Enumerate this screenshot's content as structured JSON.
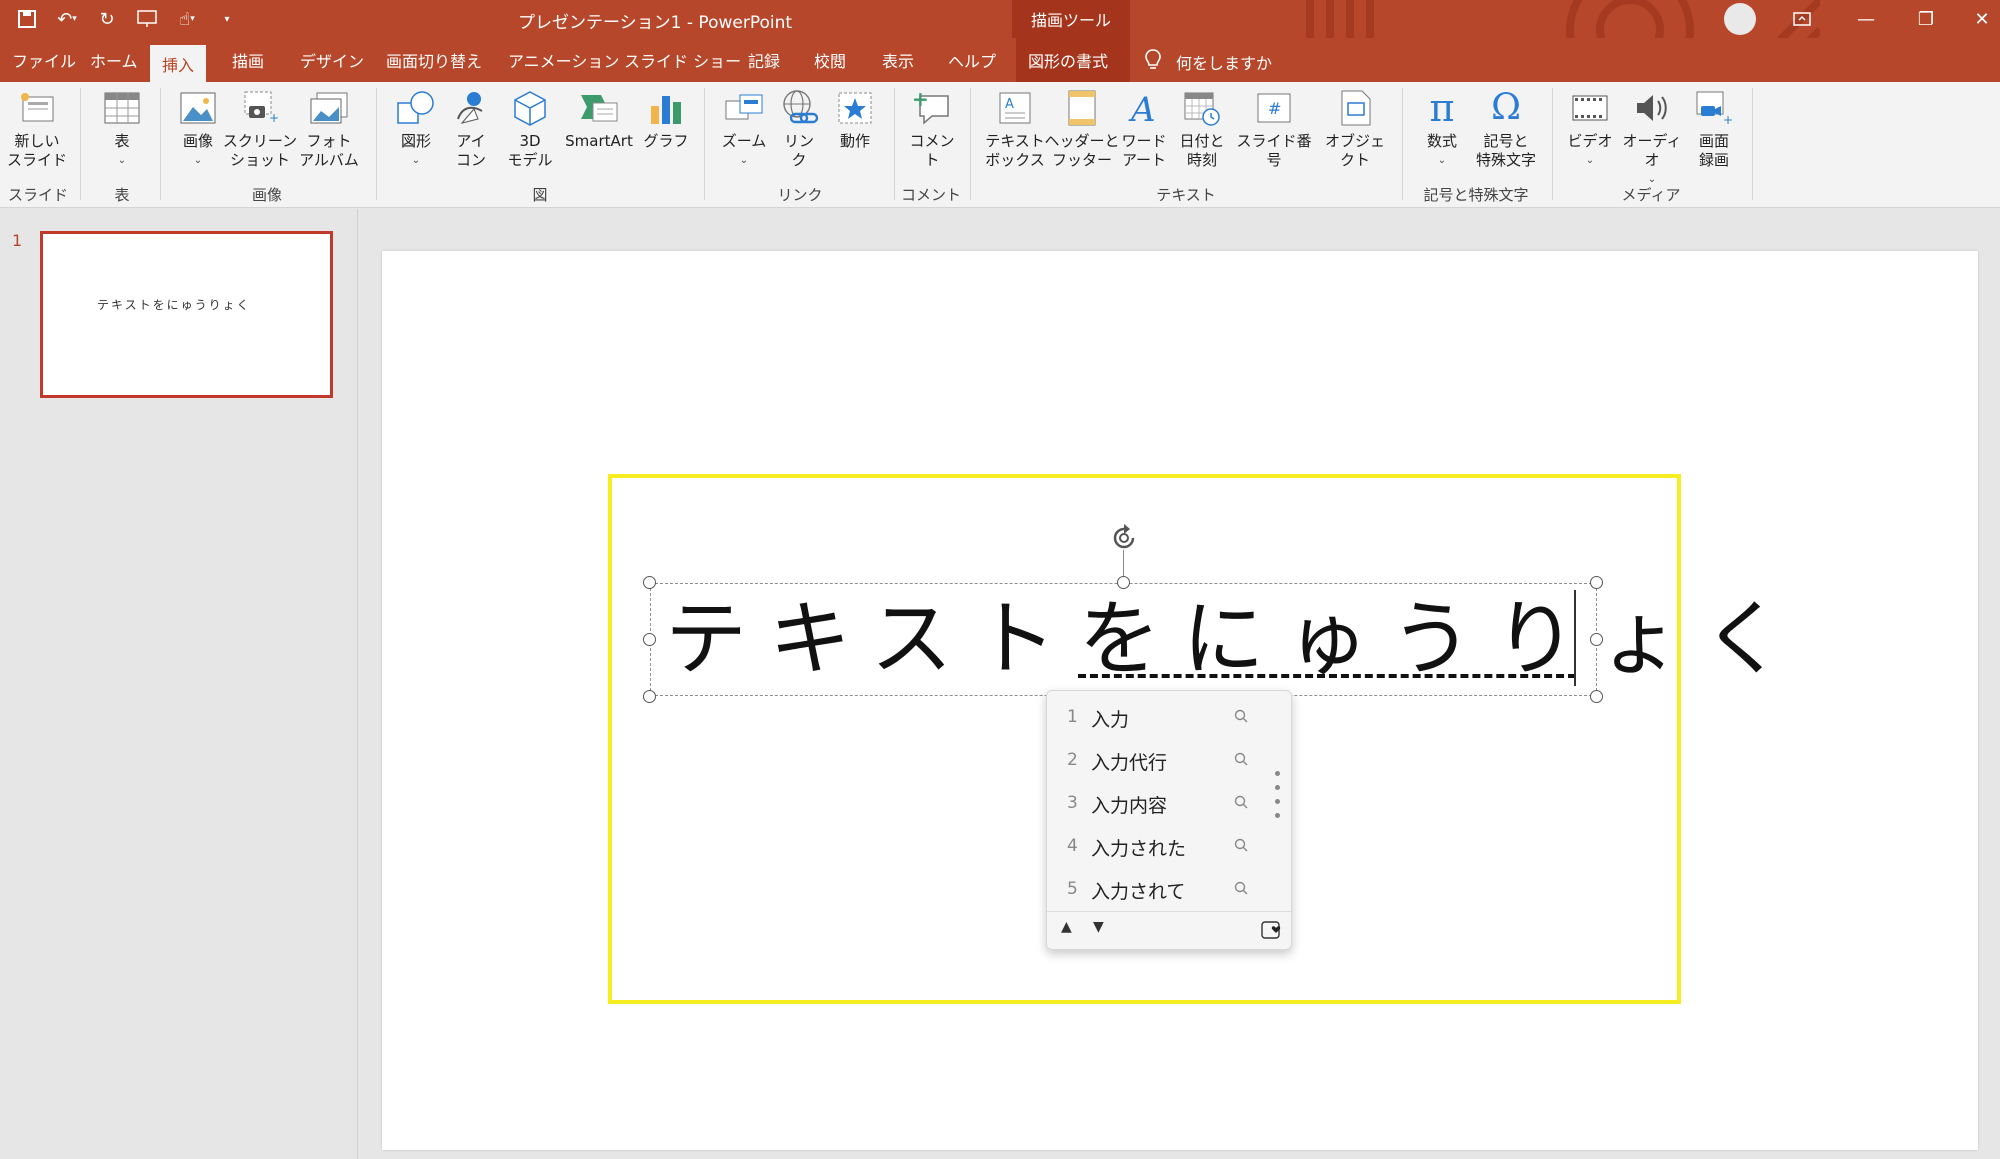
{
  "title_bar": {
    "document_title": "プレゼンテーション1  -  PowerPoint",
    "context_group": "描画ツール"
  },
  "tabs": [
    {
      "label": "ファイル"
    },
    {
      "label": "ホーム"
    },
    {
      "label": "挿入"
    },
    {
      "label": "描画"
    },
    {
      "label": "デザイン"
    },
    {
      "label": "画面切り替え"
    },
    {
      "label": "アニメーション"
    },
    {
      "label": "スライド ショー"
    },
    {
      "label": "記録"
    },
    {
      "label": "校閲"
    },
    {
      "label": "表示"
    },
    {
      "label": "ヘルプ"
    },
    {
      "label": "図形の書式"
    }
  ],
  "active_tab": "挿入",
  "tell_me": "何をしますか",
  "ribbon": {
    "buttons": {
      "new_slide": "新しい\nスライド",
      "table": "表",
      "pictures": "画像",
      "screenshot": "スクリーン\nショット",
      "photo_album": "フォト\nアルバム",
      "shapes": "図形",
      "icons": "アイ\nコン",
      "model3d": "3D\nモデル",
      "smartart": "SmartArt",
      "chart": "グラフ",
      "zoom": "ズーム",
      "link": "リン\nク",
      "action": "動作",
      "comment": "コメント",
      "textbox": "テキスト\nボックス",
      "header_footer": "ヘッダーと\nフッター",
      "wordart": "ワード\nアート",
      "datetime": "日付と\n時刻",
      "slide_number": "スライド番号",
      "object": "オブジェクト",
      "equation": "数式",
      "symbol": "記号と\n特殊文字",
      "video": "ビデオ",
      "audio": "オーディオ",
      "screen_recording": "画面\n録画"
    },
    "groups": {
      "slides": "スライド",
      "tables": "表",
      "images": "画像",
      "illustrations": "図",
      "links": "リンク",
      "comments": "コメント",
      "text": "テキスト",
      "symbols": "記号と特殊文字",
      "media": "メディア"
    }
  },
  "thumbnails": [
    {
      "number": "1",
      "text": "テキストをにゅうりょく"
    }
  ],
  "slide": {
    "text": "テキストをにゅうりょく"
  },
  "ime": {
    "candidates": [
      {
        "num": "1",
        "word": "入力"
      },
      {
        "num": "2",
        "word": "入力代行"
      },
      {
        "num": "3",
        "word": "入力内容"
      },
      {
        "num": "4",
        "word": "入力された"
      },
      {
        "num": "5",
        "word": "入力されて"
      }
    ],
    "up_icon": "▲",
    "down_icon": "▼"
  },
  "colors": {
    "accent": "#b7472a",
    "highlight": "#f7ee21"
  }
}
